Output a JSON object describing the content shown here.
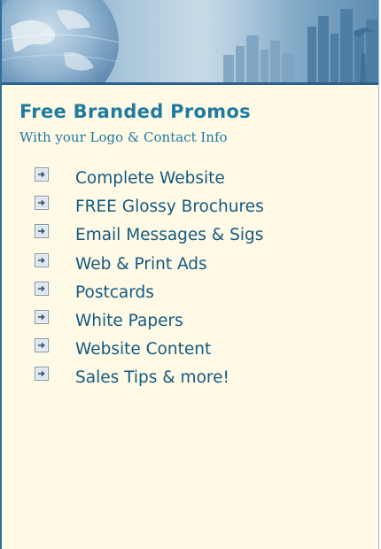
{
  "header": {
    "title": "Free Branded Promos",
    "subtitle": "With your Logo & Contact Info"
  },
  "features": {
    "items": [
      {
        "label": "Complete Website",
        "icon": "arrow-box-icon"
      },
      {
        "label": "FREE Glossy Brochures",
        "icon": "arrow-box-icon"
      },
      {
        "label": "Email Messages & Sigs",
        "icon": "arrow-box-icon"
      },
      {
        "label": "Web & Print Ads",
        "icon": "arrow-box-icon"
      },
      {
        "label": "Postcards",
        "icon": "arrow-box-icon"
      },
      {
        "label": "White Papers",
        "icon": "arrow-box-icon"
      },
      {
        "label": "Website Content",
        "icon": "arrow-box-icon"
      },
      {
        "label": "Sales Tips & more!",
        "icon": "arrow-box-icon"
      }
    ]
  },
  "colors": {
    "panel_background": "#fffae6",
    "accent_text": "#1f7aa1",
    "item_text": "#135a80",
    "banner_blue": "#6d99bc"
  }
}
